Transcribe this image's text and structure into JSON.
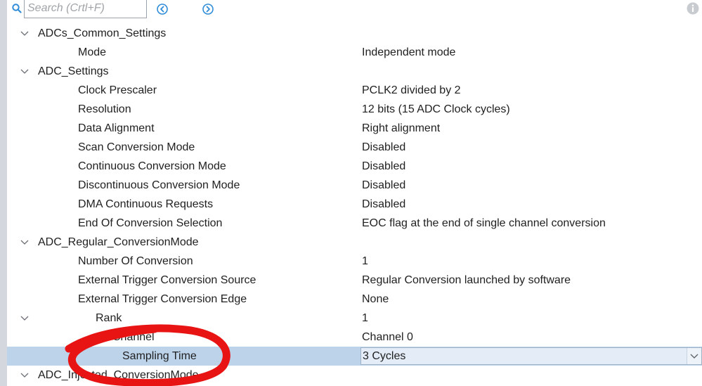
{
  "search": {
    "placeholder": "Search (Crtl+F)"
  },
  "icons": {
    "search": "search-icon",
    "previous": "circle-chevron-left-icon",
    "next": "circle-chevron-right-icon",
    "info": "info-icon",
    "expand": "chevron-down-icon",
    "dropdown": "chevron-down-icon"
  },
  "colors": {
    "accent": "#2f8cd8",
    "selection": "#bcd3ea",
    "annotation": "#e81414"
  },
  "tree": {
    "adcs_common": {
      "title": "ADCs_Common_Settings",
      "mode_label": "Mode",
      "mode_value": "Independent mode"
    },
    "adc_settings": {
      "title": "ADC_Settings",
      "clock_prescaler_label": "Clock Prescaler",
      "clock_prescaler_value": "PCLK2 divided by 2",
      "resolution_label": "Resolution",
      "resolution_value": "12 bits (15 ADC Clock cycles)",
      "data_alignment_label": "Data Alignment",
      "data_alignment_value": "Right alignment",
      "scan_mode_label": "Scan Conversion Mode",
      "scan_mode_value": "Disabled",
      "continuous_label": "Continuous Conversion Mode",
      "continuous_value": "Disabled",
      "discontinuous_label": "Discontinuous Conversion Mode",
      "discontinuous_value": "Disabled",
      "dma_label": "DMA Continuous Requests",
      "dma_value": "Disabled",
      "eoc_label": "End Of Conversion Selection",
      "eoc_value": "EOC flag at the end of single channel conversion"
    },
    "adc_regular": {
      "title": "ADC_Regular_ConversionMode",
      "num_conversion_label": "Number Of Conversion",
      "num_conversion_value": "1",
      "ext_trigger_source_label": "External Trigger Conversion Source",
      "ext_trigger_source_value": "Regular Conversion launched by software",
      "ext_trigger_edge_label": "External Trigger Conversion Edge",
      "ext_trigger_edge_value": "None",
      "rank_label": "Rank",
      "rank_value": "1",
      "channel_label": "Channel",
      "channel_value": "Channel 0",
      "sampling_label": "Sampling Time",
      "sampling_value": "3 Cycles"
    },
    "adc_injected": {
      "title": "ADC_Injected_ConversionMode"
    }
  }
}
